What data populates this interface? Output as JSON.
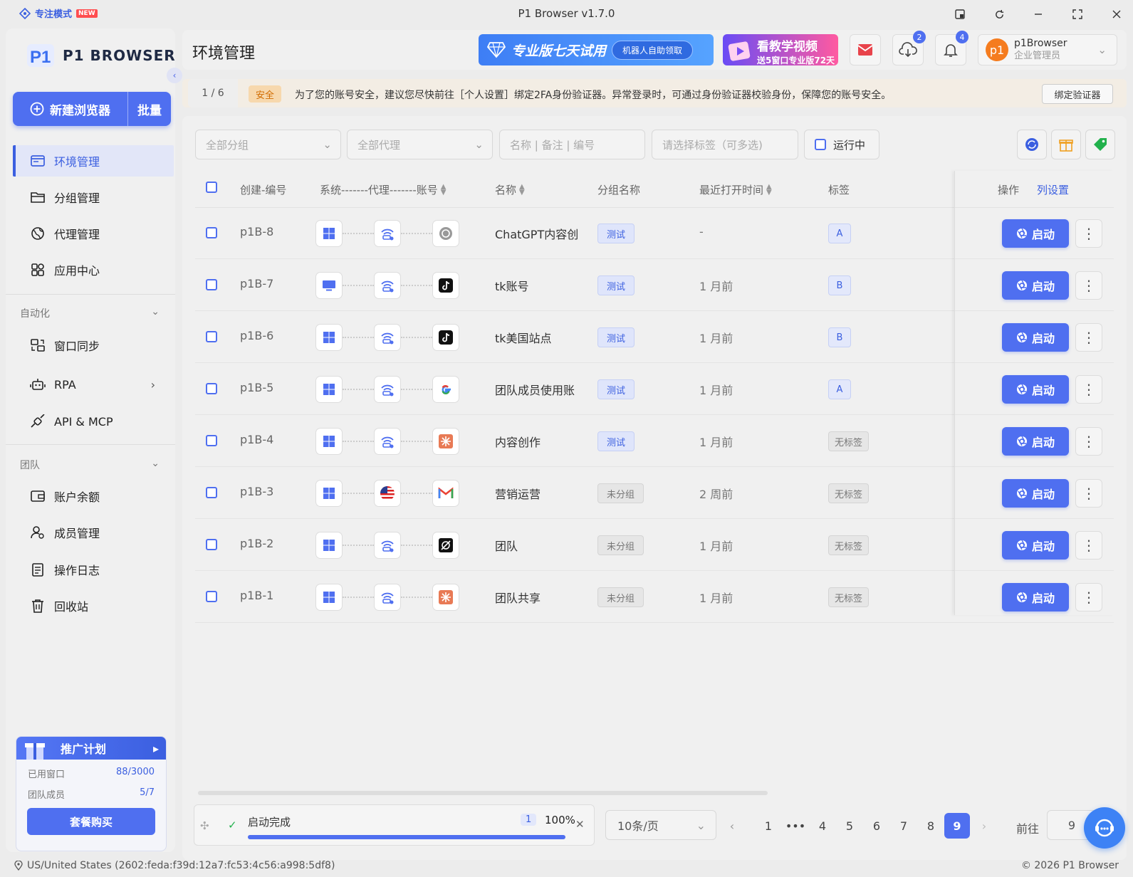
{
  "window": {
    "focus_mode": "专注模式",
    "new_badge": "NEW",
    "title": "P1 Browser v1.7.0"
  },
  "sidebar": {
    "logo_text": "P1 BROWSER",
    "new_browser": "新建浏览器",
    "batch": "批量",
    "nav": [
      {
        "label": "环境管理",
        "icon": "browser-window-icon"
      },
      {
        "label": "分组管理",
        "icon": "folder-icon"
      },
      {
        "label": "代理管理",
        "icon": "globe-icon"
      },
      {
        "label": "应用中心",
        "icon": "apps-grid-icon"
      }
    ],
    "automation_section": "自动化",
    "automation": [
      {
        "label": "窗口同步",
        "icon": "window-sync-icon"
      },
      {
        "label": "RPA",
        "icon": "robot-icon"
      },
      {
        "label": "API & MCP",
        "icon": "plug-icon"
      }
    ],
    "team_section": "团队",
    "team": [
      {
        "label": "账户余额",
        "icon": "wallet-icon"
      },
      {
        "label": "成员管理",
        "icon": "members-icon"
      },
      {
        "label": "操作日志",
        "icon": "clipboard-icon"
      },
      {
        "label": "回收站",
        "icon": "trash-icon"
      }
    ],
    "promo": {
      "title": "推广计划",
      "used_windows_label": "已用窗口",
      "used_windows_value": "88/3000",
      "team_members_label": "团队成员",
      "team_members_value": "5/7",
      "buy_button": "套餐购买"
    }
  },
  "header": {
    "page_title": "环境管理",
    "trial_banner": "专业版七天试用",
    "trial_pill": "机器人自助领取",
    "tutorial_line1": "看教学视频",
    "tutorial_line2": "送5窗口专业版72天",
    "download_badge": "2",
    "notification_badge": "4",
    "avatar_text": "p1",
    "username": "p1Browser",
    "user_role": "企业管理员"
  },
  "notice": {
    "count": "1 / 6",
    "tag": "安全",
    "text": "为了您的账号安全，建议您尽快前往［个人设置］绑定2FA身份验证器。异常登录时，可通过身份验证器校验身份，保障您的账号安全。",
    "button": "绑定验证器"
  },
  "filters": {
    "group_placeholder": "全部分组",
    "proxy_placeholder": "全部代理",
    "search_placeholder": "名称 | 备注 | 编号",
    "tags_placeholder": "请选择标签（可多选)",
    "running_label": "运行中"
  },
  "table": {
    "columns": {
      "id": "创建-编号",
      "system": "系统-------代理-------账号",
      "name": "名称",
      "group": "分组名称",
      "last_open": "最近打开时间",
      "tags": "标签",
      "actions": "操作",
      "column_settings": "列设置"
    },
    "launch_label": "启动",
    "rows": [
      {
        "id": "p1B-8",
        "os": "windows",
        "proxy": "wifi-proxy",
        "account": "chatgpt",
        "name": "ChatGPT内容创",
        "group": "测试",
        "group_type": "test",
        "last_open": "-",
        "tag": "A",
        "tag_type": "letter"
      },
      {
        "id": "p1B-7",
        "os": "monitor",
        "proxy": "wifi-proxy",
        "account": "tiktok",
        "name": "tk账号",
        "group": "测试",
        "group_type": "test",
        "last_open": "1 月前",
        "tag": "B",
        "tag_type": "letter"
      },
      {
        "id": "p1B-6",
        "os": "windows",
        "proxy": "wifi-proxy",
        "account": "tiktok",
        "name": "tk美国站点",
        "group": "测试",
        "group_type": "test",
        "last_open": "1 月前",
        "tag": "B",
        "tag_type": "letter"
      },
      {
        "id": "p1B-5",
        "os": "windows",
        "proxy": "wifi-proxy",
        "account": "google",
        "name": "团队成员使用账",
        "group": "测试",
        "group_type": "test",
        "last_open": "1 月前",
        "tag": "A",
        "tag_type": "letter"
      },
      {
        "id": "p1B-4",
        "os": "windows",
        "proxy": "wifi-proxy",
        "account": "claude",
        "name": "内容创作",
        "group": "测试",
        "group_type": "test",
        "last_open": "1 月前",
        "tag": "无标签",
        "tag_type": "none"
      },
      {
        "id": "p1B-3",
        "os": "windows",
        "proxy": "us-flag",
        "account": "gmail",
        "name": "营销运营",
        "group": "未分组",
        "group_type": "none",
        "last_open": "2 周前",
        "tag": "无标签",
        "tag_type": "none"
      },
      {
        "id": "p1B-2",
        "os": "windows",
        "proxy": "wifi-proxy",
        "account": "grok",
        "name": "团队",
        "group": "未分组",
        "group_type": "none",
        "last_open": "1 月前",
        "tag": "无标签",
        "tag_type": "none"
      },
      {
        "id": "p1B-1",
        "os": "windows",
        "proxy": "wifi-proxy",
        "account": "claude",
        "name": "团队共享",
        "group": "未分组",
        "group_type": "none",
        "last_open": "1 月前",
        "tag": "无标签",
        "tag_type": "none"
      }
    ]
  },
  "progress": {
    "status": "启动完成",
    "count": "1",
    "percent_label": "100%",
    "percent": 100
  },
  "pagination": {
    "per_page": "10条/页",
    "pages": [
      "1",
      "•••",
      "4",
      "5",
      "6",
      "7",
      "8",
      "9"
    ],
    "current": "9",
    "goto_label": "前往",
    "goto_value": "9"
  },
  "status_bar": {
    "location": "US/United States (2602:feda:f39d:12a7:fc53:4c56:a998:5df8)",
    "copyright": "© 2026 P1 Browser"
  },
  "colors": {
    "accent": "#4f6ff0",
    "avatar": "#f57c1f",
    "notice_bg": "#f3ede4",
    "safe_tag": "#d06b00"
  }
}
